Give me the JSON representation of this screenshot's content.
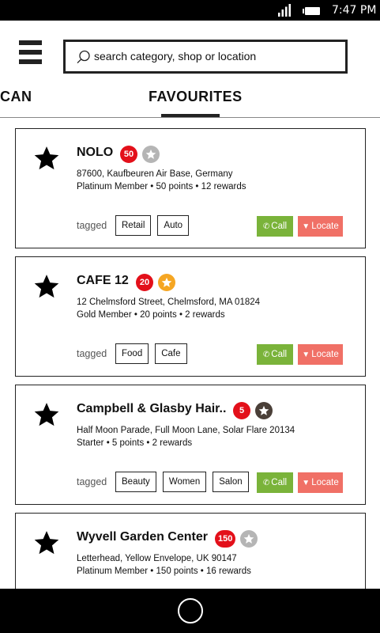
{
  "status_bar": {
    "time": "7:47 PM",
    "icons": [
      "signal-icon",
      "battery-icon"
    ]
  },
  "header": {
    "menu_icon": "hamburger-menu-icon",
    "search": {
      "placeholder": "search category, shop or location",
      "value": "",
      "icon": "search-icon"
    }
  },
  "tabs": [
    {
      "label": "CAN",
      "active": false
    },
    {
      "label": "FAVOURITES",
      "active": true
    }
  ],
  "colors": {
    "points_badge": "#e3101a",
    "tier_platinum": "#b5b5b5",
    "tier_gold": "#f5a623",
    "tier_starter": "#4a3f38",
    "call": "#7ab33a",
    "locate": "#f07066"
  },
  "actions": {
    "tagged_label": "tagged",
    "call_label": "Call",
    "call_icon": "phone-icon",
    "locate_label": "Locate",
    "locate_icon": "map-pin-icon"
  },
  "favourites": [
    {
      "name": "NOLO",
      "points_badge": "50",
      "tier": "platinum",
      "address": "87600, Kaufbeuren Air Base, Germany",
      "membership": "Platinum Member • 50 points • 12 rewards",
      "tags": [
        "Retail",
        "Auto"
      ]
    },
    {
      "name": "CAFE 12",
      "points_badge": "20",
      "tier": "gold",
      "address": "12 Chelmsford Street, Chelmsford, MA 01824",
      "membership": "Gold Member • 20 points • 2 rewards",
      "tags": [
        "Food",
        "Cafe"
      ]
    },
    {
      "name": "Campbell & Glasby Hair..",
      "points_badge": "5",
      "tier": "starter",
      "address": "Half Moon Parade, Full Moon Lane, Solar Flare 20134",
      "membership": "Starter • 5 points • 2 rewards",
      "tags": [
        "Beauty",
        "Women",
        "Salon"
      ]
    },
    {
      "name": "Wyvell Garden Center",
      "points_badge": "150",
      "tier": "platinum",
      "address": "Letterhead, Yellow Envelope, UK 90147",
      "membership": "Platinum Member • 150 points • 16 rewards",
      "tags": []
    }
  ],
  "bottom_nav": {
    "home_icon": "home-circle-icon"
  }
}
